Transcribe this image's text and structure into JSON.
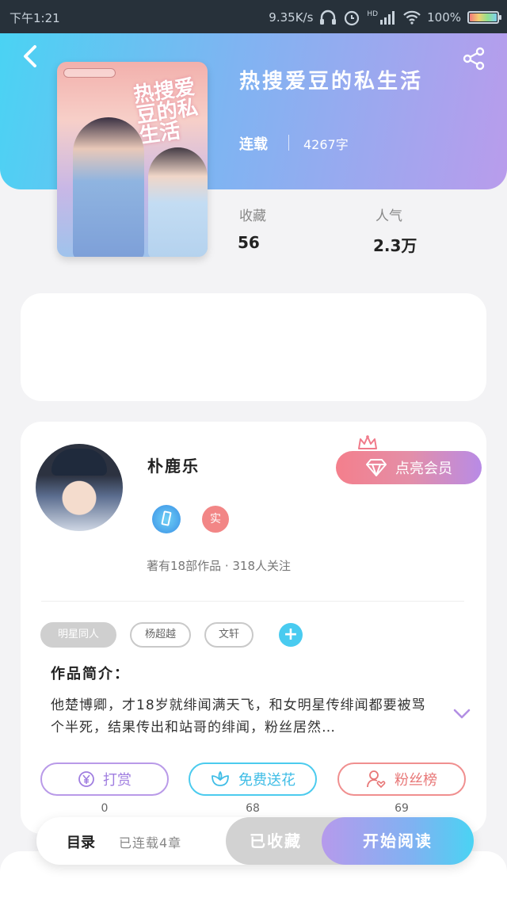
{
  "status_bar": {
    "time": "下午1:21",
    "speed": "9.35K/s",
    "network": "HD",
    "battery": "100%"
  },
  "book": {
    "title": "热搜爱豆的私生活",
    "cover_text": "热搜爱豆的私生活",
    "status": "连载",
    "word_count": "4267字",
    "stats": [
      {
        "label": "收藏",
        "value": "56"
      },
      {
        "label": "人气",
        "value": "2.3万"
      }
    ]
  },
  "author": {
    "name": "朴鹿乐",
    "badge_real": "实",
    "meta": "著有18部作品 · 318人关注",
    "vip_label": "点亮会员"
  },
  "tags": [
    "明星同人",
    "杨超越",
    "文轩"
  ],
  "intro": {
    "label": "作品简介：",
    "text": "他楚博卿，才18岁就绯闻满天飞，和女明星传绯闻都要被骂个半死，结果传出和站哥的绯闻，粉丝居然…"
  },
  "actions": [
    {
      "label": "打赏",
      "count": "0",
      "icon": "yen-icon"
    },
    {
      "label": "免费送花",
      "count": "68",
      "icon": "flower-icon"
    },
    {
      "label": "粉丝榜",
      "count": "69",
      "icon": "user-heart-icon"
    }
  ],
  "bottom": {
    "toc_label": "目录",
    "toc_sub": "已连载4章",
    "collected_label": "已收藏",
    "read_label": "开始阅读"
  },
  "colors": {
    "header_start": "#4ad3f3",
    "header_end": "#b99cec",
    "vip_start": "#f47f8c",
    "vip_end": "#b88be6"
  }
}
